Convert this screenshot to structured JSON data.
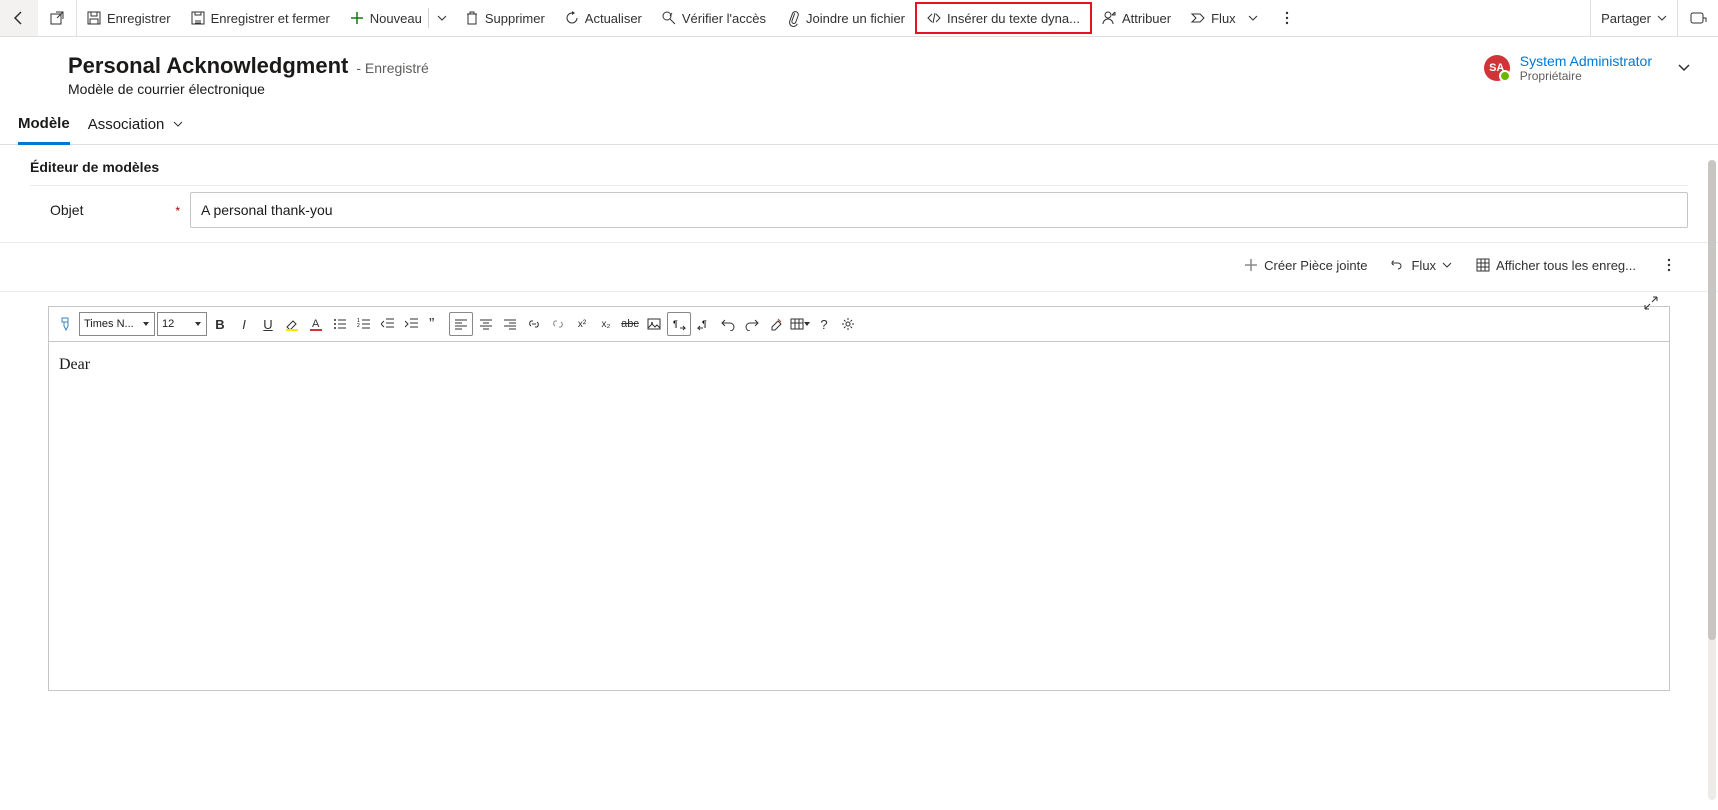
{
  "commandbar": {
    "back": "Retour",
    "popout": "Ouvrir",
    "save": "Enregistrer",
    "saveclose": "Enregistrer et fermer",
    "new": "Nouveau",
    "delete": "Supprimer",
    "refresh": "Actualiser",
    "checkaccess": "Vérifier l'accès",
    "attach": "Joindre un fichier",
    "insertdyn": "Insérer du texte dyna...",
    "assign": "Attribuer",
    "flow": "Flux",
    "share": "Partager"
  },
  "header": {
    "title": "Personal Acknowledgment",
    "status": "- Enregistré",
    "subtitle": "Modèle de courrier électronique"
  },
  "owner": {
    "initials": "SA",
    "name": "System Administrator",
    "role": "Propriétaire"
  },
  "tabs": {
    "tab1": "Modèle",
    "tab2": "Association"
  },
  "section": {
    "title": "Éditeur de modèles",
    "field_label": "Objet",
    "field_value": "A personal thank-you"
  },
  "subbar": {
    "create_attach": "Créer Pièce jointe",
    "flow": "Flux",
    "showall": "Afficher tous les enreg..."
  },
  "editor": {
    "font_name": "Times N...",
    "font_size": "12",
    "body": "Dear"
  }
}
